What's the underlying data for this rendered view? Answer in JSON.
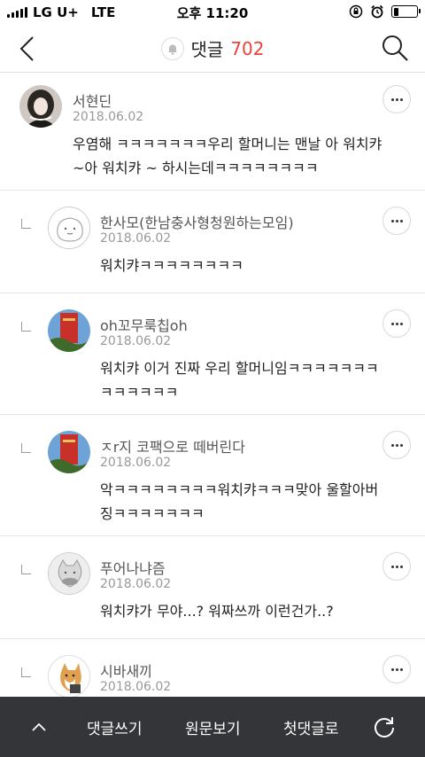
{
  "status": {
    "carrier": "LG U+",
    "network": "LTE",
    "time": "오후 11:20",
    "battery_level": 0.2
  },
  "header": {
    "title": "댓글",
    "count": "702"
  },
  "comments": [
    {
      "name": "서현딘",
      "date": "2018.06.02",
      "lines": [
        "우염해 ㅋㅋㅋㅋㅋㅋㅋ우리 할머니는 맨날 아 워치캬",
        "~아 워치캬 ~ 하시는데ㅋㅋㅋㅋㅋㅋㅋㅋ"
      ]
    },
    {
      "name": "한사모(한남충사형청원하는모임)",
      "date": "2018.06.02",
      "lines": [
        "워치캬ㅋㅋㅋㅋㅋㅋㅋㅋ"
      ]
    },
    {
      "name": "oh꼬무룩칩oh",
      "date": "2018.06.02",
      "lines": [
        "워치캬 이거 진짜 우리 할머니임ㅋㅋㅋㅋㅋㅋㅋ",
        "ㅋㅋㅋㅋㅋㅋ"
      ]
    },
    {
      "name": "ㅈr지 코팩으로 떼버린다",
      "date": "2018.06.02",
      "lines": [
        "악ㅋㅋㅋㅋㅋㅋㅋㅋ워치캬ㅋㅋㅋ맞아 울할아버",
        "징ㅋㅋㅋㅋㅋㅋㅋ"
      ]
    },
    {
      "name": "푸어나냐즘",
      "date": "2018.06.02",
      "lines": [
        "워치캬가 무야...?  워짜쓰까 이런건가..?"
      ]
    },
    {
      "name": "시바새끼",
      "date": "2018.06.02"
    }
  ],
  "bottom_bar": {
    "write": "댓글쓰기",
    "original": "원문보기",
    "first": "첫댓글로"
  },
  "icons": {
    "back": "chevron-left-icon",
    "bell": "bell-icon",
    "search": "search-icon",
    "more": "more-dots-icon",
    "reply": "reply-corner-icon",
    "up": "chevron-up-icon",
    "refresh": "refresh-icon"
  },
  "colors": {
    "accent": "#e8423c",
    "bottom_bar": "#333538"
  }
}
